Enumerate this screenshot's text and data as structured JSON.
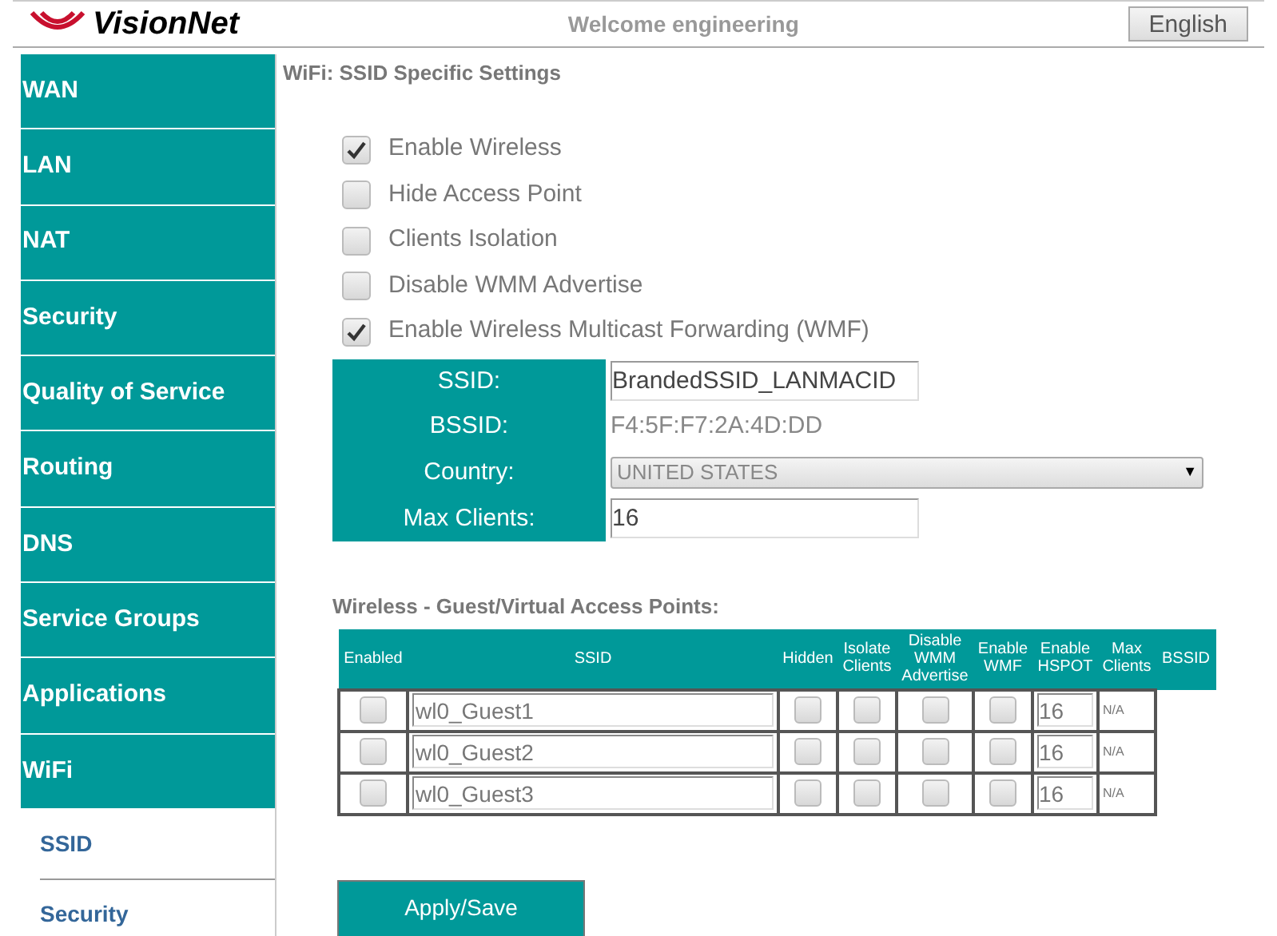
{
  "header": {
    "logo": "VisionNet",
    "welcome": "Welcome engineering",
    "language_button": "English"
  },
  "sidebar": {
    "items": [
      {
        "label": "WAN"
      },
      {
        "label": "LAN"
      },
      {
        "label": "NAT"
      },
      {
        "label": "Security"
      },
      {
        "label": "Quality of Service"
      },
      {
        "label": "Routing"
      },
      {
        "label": "DNS"
      },
      {
        "label": "Service Groups"
      },
      {
        "label": "Applications"
      },
      {
        "label": "WiFi"
      }
    ],
    "sub_items": [
      {
        "label": "SSID"
      },
      {
        "label": "Security"
      }
    ]
  },
  "page_title": "WiFi: SSID Specific Settings",
  "options": [
    {
      "label": "Enable Wireless",
      "checked": true
    },
    {
      "label": "Hide Access Point",
      "checked": false
    },
    {
      "label": "Clients Isolation",
      "checked": false
    },
    {
      "label": "Disable WMM Advertise",
      "checked": false
    },
    {
      "label": "Enable Wireless Multicast Forwarding (WMF)",
      "checked": true
    }
  ],
  "settings": [
    {
      "kind": "input",
      "label": "SSID:",
      "value": "BrandedSSID_LANMACID"
    },
    {
      "kind": "text",
      "label": "BSSID:",
      "value": "F4:5F:F7:2A:4D:DD"
    },
    {
      "kind": "select",
      "label": "Country:",
      "value": "UNITED STATES",
      "arrow": "▼"
    },
    {
      "kind": "input",
      "label": "Max Clients:",
      "value": "16"
    }
  ],
  "guest_section": {
    "title": "Wireless - Guest/Virtual Access Points:",
    "columns": [
      "Enabled",
      "SSID",
      "Hidden",
      "Isolate Clients",
      "Disable WMM Advertise",
      "Enable WMF",
      "Enable HSPOT",
      "Max Clients",
      "BSSID"
    ],
    "rows": [
      {
        "enabled": false,
        "ssid": "wl0_Guest1",
        "hidden": false,
        "isolate": false,
        "disable_wmm": false,
        "wmf": false,
        "value_1": "16",
        "value_2": "N/A"
      },
      {
        "enabled": false,
        "ssid": "wl0_Guest2",
        "hidden": false,
        "isolate": false,
        "disable_wmm": false,
        "wmf": false,
        "value_1": "16",
        "value_2": "N/A"
      },
      {
        "enabled": false,
        "ssid": "wl0_Guest3",
        "hidden": false,
        "isolate": false,
        "disable_wmm": false,
        "wmf": false,
        "value_1": "16",
        "value_2": "N/A"
      }
    ]
  },
  "apply_button": "Apply/Save"
}
